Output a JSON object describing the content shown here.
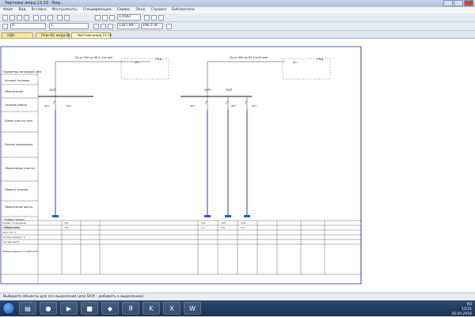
{
  "window": {
    "title": "Чертежи жкрд.13.10 - Вид..",
    "menu": [
      "Файл",
      "Вид",
      "Вставка",
      "Инструменты",
      "Спецификация",
      "Сервис",
      "Окно",
      "Справка",
      "Библиотеки"
    ]
  },
  "toolbar": {
    "scale_value": "1.0567",
    "layer_value": "0",
    "style_value": "1",
    "coords_value": "1167.84",
    "coords_value2": "196.178"
  },
  "tabs": [
    {
      "label": "ОДН"
    },
    {
      "label": "План ВС жкрд.08.10"
    },
    {
      "label": "Чертежи жкрд.13.10"
    }
  ],
  "drawing": {
    "feeder_left": "Пр от 400 яч.36 0, 3х4 мм²",
    "feeder_right": "Пр от 400 яч.В3 0,5х25 мм²",
    "box_label": "ГРЩ",
    "breaker_codes": [
      "QF1",
      "QF2",
      "QF3"
    ],
    "bus_labels": [
      "1КЗТ",
      "2КЗТ",
      "3КЗТ"
    ],
    "left_table_rows": [
      "Параметры питающей сети",
      "Аппарат на вводе",
      "Обозначение",
      "Сечение кабеля",
      "Длина участка сети",
      "Потеря напряжения",
      "Обозначение участка",
      "Марка и сечение",
      "Обозначение щитка",
      "Номер группы",
      "Мощность"
    ],
    "bottom_row_labels": [
      "Номер стр.раздела",
      "Ном.уст. мощн.",
      "Расч.ток. А",
      "Потеря напряж. %",
      "Тип автомата",
      "Наименование потребителя"
    ],
    "bottom_codes": [
      "Гр1",
      "Гр2",
      "Гр3",
      "Гр4"
    ],
    "values_row": [
      "1,8",
      "1,2",
      "3,6",
      "2,4"
    ]
  },
  "status": {
    "hint": "Выберите объекты для его выделения (или Shift - добавить к выделению)"
  },
  "taskbar": {
    "time": "13:21",
    "date": "26.04.2016",
    "lang": "RU"
  }
}
